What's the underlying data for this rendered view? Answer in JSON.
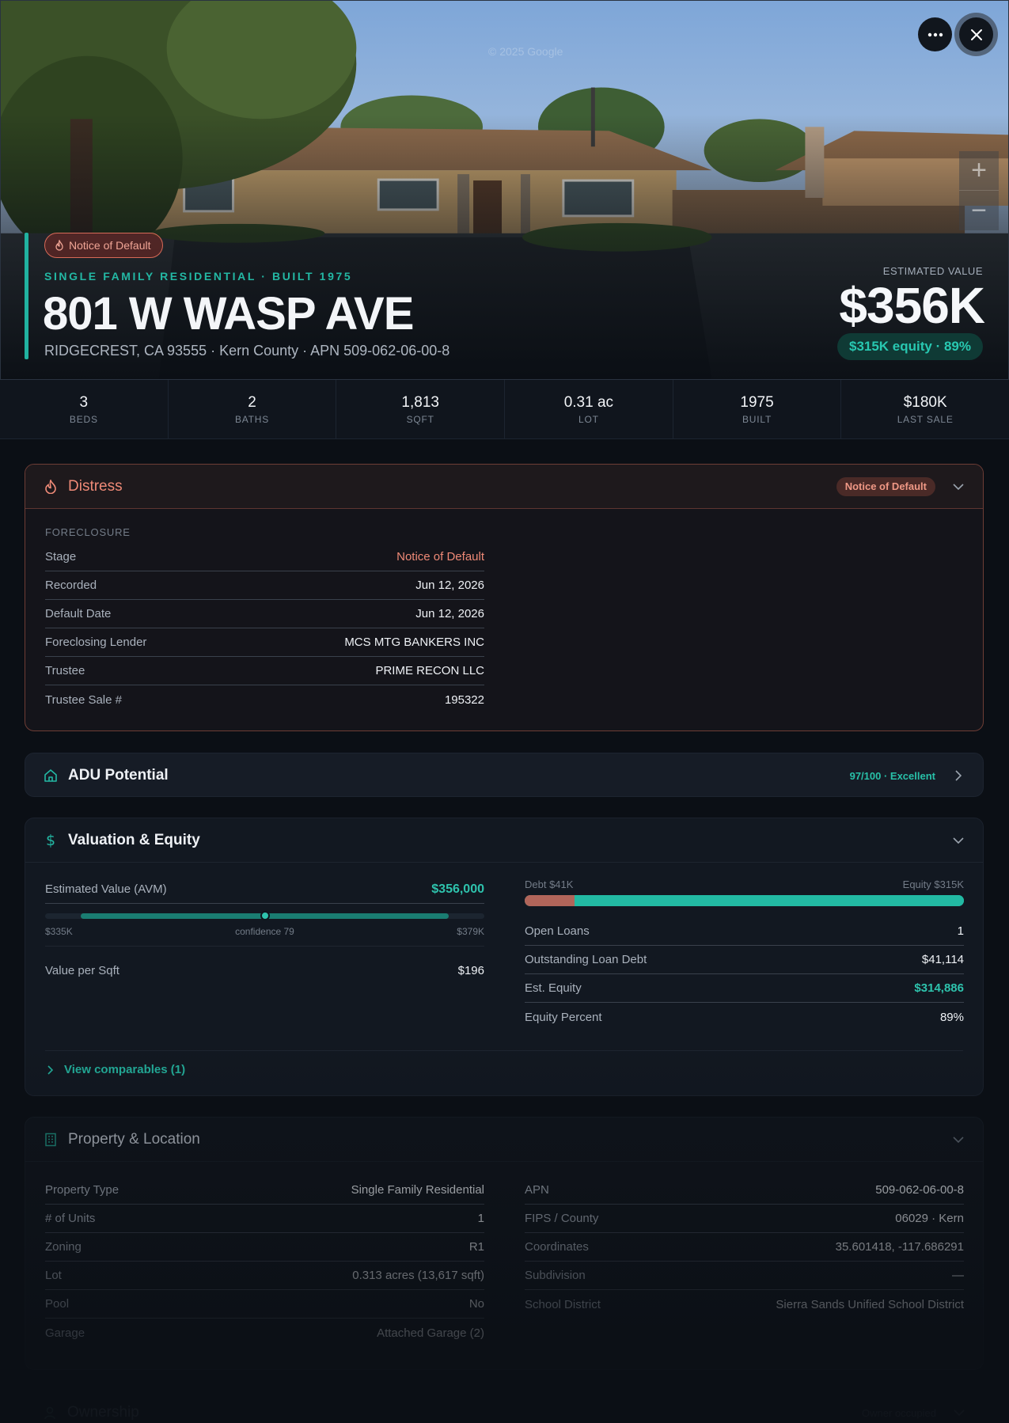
{
  "hero": {
    "watermark": "© 2025 Google",
    "badge": "Notice of Default",
    "subtitle": "SINGLE FAMILY RESIDENTIAL · BUILT 1975",
    "title": "801 W WASP AVE",
    "address_line": "RIDGECREST, CA 93555 · Kern County · APN 509-062-06-00-8",
    "estimated_label": "ESTIMATED VALUE",
    "estimated_value": "$356K",
    "equity_pill": "$315K equity · 89%",
    "zoom_in": "+",
    "zoom_out": "−"
  },
  "stats": [
    {
      "value": "3",
      "label": "BEDS"
    },
    {
      "value": "2",
      "label": "BATHS"
    },
    {
      "value": "1,813",
      "label": "SQFT"
    },
    {
      "value": "0.31 ac",
      "label": "LOT"
    },
    {
      "value": "1975",
      "label": "BUILT"
    },
    {
      "value": "$180K",
      "label": "LAST SALE"
    }
  ],
  "distress": {
    "title": "Distress",
    "badge": "Notice of Default",
    "section": "FORECLOSURE",
    "rows": [
      {
        "k": "Stage",
        "v": "Notice of Default"
      },
      {
        "k": "Recorded",
        "v": "Jun 12, 2026"
      },
      {
        "k": "Default Date",
        "v": "Jun 12, 2026"
      },
      {
        "k": "Foreclosing Lender",
        "v": "MCS MTG BANKERS INC"
      },
      {
        "k": "Trustee",
        "v": "PRIME RECON LLC"
      },
      {
        "k": "Trustee Sale #",
        "v": "195322"
      }
    ]
  },
  "adu": {
    "title": "ADU Potential",
    "score": "97/100 · Excellent"
  },
  "valuation": {
    "title": "Valuation & Equity",
    "avm_label": "Estimated Value (AVM)",
    "avm_value": "$356,000",
    "range_low": "$335K",
    "range_high": "$379K",
    "confidence": "confidence 79",
    "range_marker_fraction": 0.5,
    "per_sqft_label": "Value per Sqft",
    "per_sqft_value": "$196",
    "debt_label": "Debt $41K",
    "equity_label": "Equity $315K",
    "equity_fraction": 0.886,
    "rows": [
      {
        "k": "Open Loans",
        "v": "1"
      },
      {
        "k": "Outstanding Loan Debt",
        "v": "$41,114"
      },
      {
        "k": "Est. Equity",
        "v": "$314,886"
      },
      {
        "k": "Equity Percent",
        "v": "89%"
      }
    ],
    "comparables_link": "View comparables (1)",
    "colors": {
      "debt": "#b1655a",
      "equity": "#22b9a3"
    }
  },
  "property": {
    "title": "Property & Location",
    "left": [
      {
        "k": "Property Type",
        "v": "Single Family Residential"
      },
      {
        "k": "# of Units",
        "v": "1"
      },
      {
        "k": "Zoning",
        "v": "R1"
      },
      {
        "k": "Lot",
        "v": "0.313 acres (13,617 sqft)"
      },
      {
        "k": "Pool",
        "v": "No"
      },
      {
        "k": "Garage",
        "v": "Attached Garage (2)"
      }
    ],
    "right": [
      {
        "k": "APN",
        "v": "509-062-06-00-8"
      },
      {
        "k": "FIPS / County",
        "v": "06029 · Kern"
      },
      {
        "k": "Coordinates",
        "v": "35.601418, -117.686291"
      },
      {
        "k": "Subdivision",
        "v": "—"
      },
      {
        "k": "School District",
        "v": "Sierra Sands Unified School District"
      }
    ]
  },
  "ownership": {
    "title": "Ownership",
    "badge": "Owner occupied"
  }
}
